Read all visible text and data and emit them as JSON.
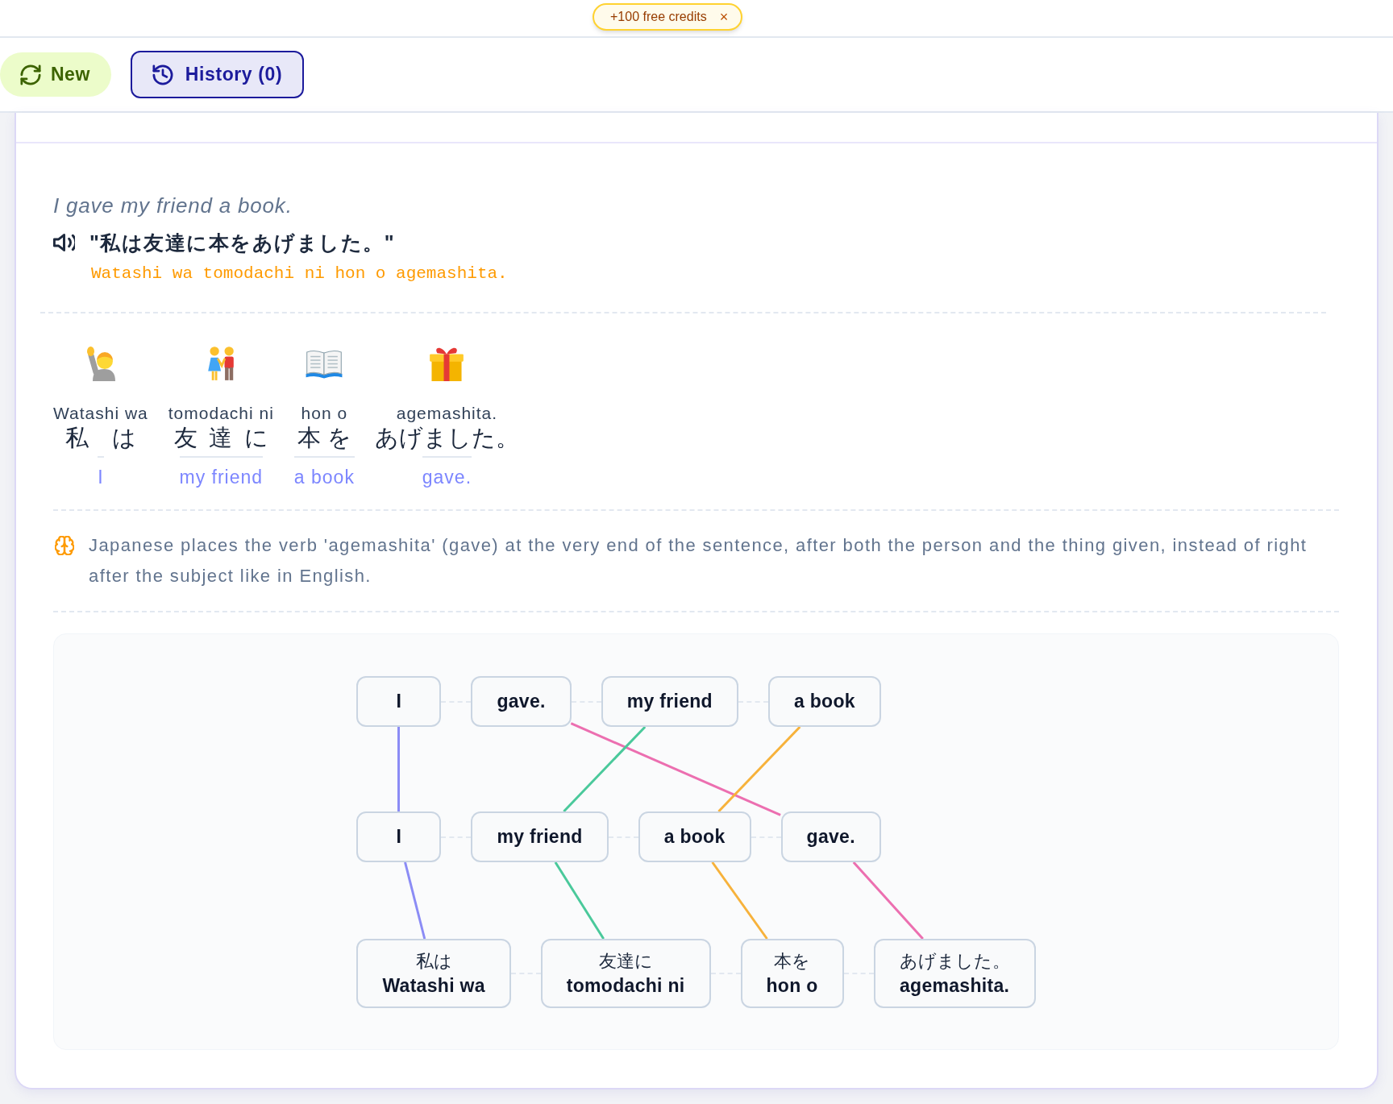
{
  "banner": {
    "text": "+100 free credits",
    "close": "×"
  },
  "toolbar": [
    {
      "kind": "new",
      "label": "New"
    },
    {
      "kind": "history",
      "label": "History (0)"
    }
  ],
  "sentence": {
    "english": "I gave my friend a book.",
    "japanese": "\"私は友達に本をあげました。\"",
    "romaji": "Watashi wa tomodachi ni hon o agemashita."
  },
  "words": [
    {
      "romaji": "Watashi wa",
      "japanese": "私は",
      "english": "I"
    },
    {
      "romaji": "tomodachi ni",
      "japanese": "友達に",
      "english": "my friend"
    },
    {
      "romaji": "hon o",
      "japanese": "本を",
      "english": "a book"
    },
    {
      "romaji": "agemashita.",
      "japanese": "あげました。",
      "english": "gave."
    }
  ],
  "note": "Japanese places the verb 'agemashita' (gave) at the very end of the sentence, after both the person and the thing given, instead of right after the subject like in English.",
  "diagram": {
    "rows": [
      {
        "kind": "single",
        "nodes": [
          {
            "label": "I"
          },
          {
            "label": "gave."
          },
          {
            "label": "my friend"
          },
          {
            "label": "a book"
          }
        ]
      },
      {
        "kind": "single",
        "nodes": [
          {
            "label": "I",
            "color": "#8b8cf5"
          },
          {
            "label": "my friend",
            "color": "#4ac99b"
          },
          {
            "label": "a book",
            "color": "#f7b23b"
          },
          {
            "label": "gave.",
            "color": "#ec6fb0"
          }
        ]
      },
      {
        "kind": "double",
        "nodes": [
          {
            "japanese": "私は",
            "romaji": "Watashi wa"
          },
          {
            "japanese": "友達に",
            "romaji": "tomodachi ni"
          },
          {
            "japanese": "本を",
            "romaji": "hon o"
          },
          {
            "japanese": "あげました。",
            "romaji": "agemashita."
          }
        ]
      }
    ],
    "links": [
      {
        "color": "#8b8cf5"
      },
      {
        "color": "#ec6fb0"
      },
      {
        "color": "#4ac99b"
      },
      {
        "color": "#f7b23b"
      }
    ]
  }
}
